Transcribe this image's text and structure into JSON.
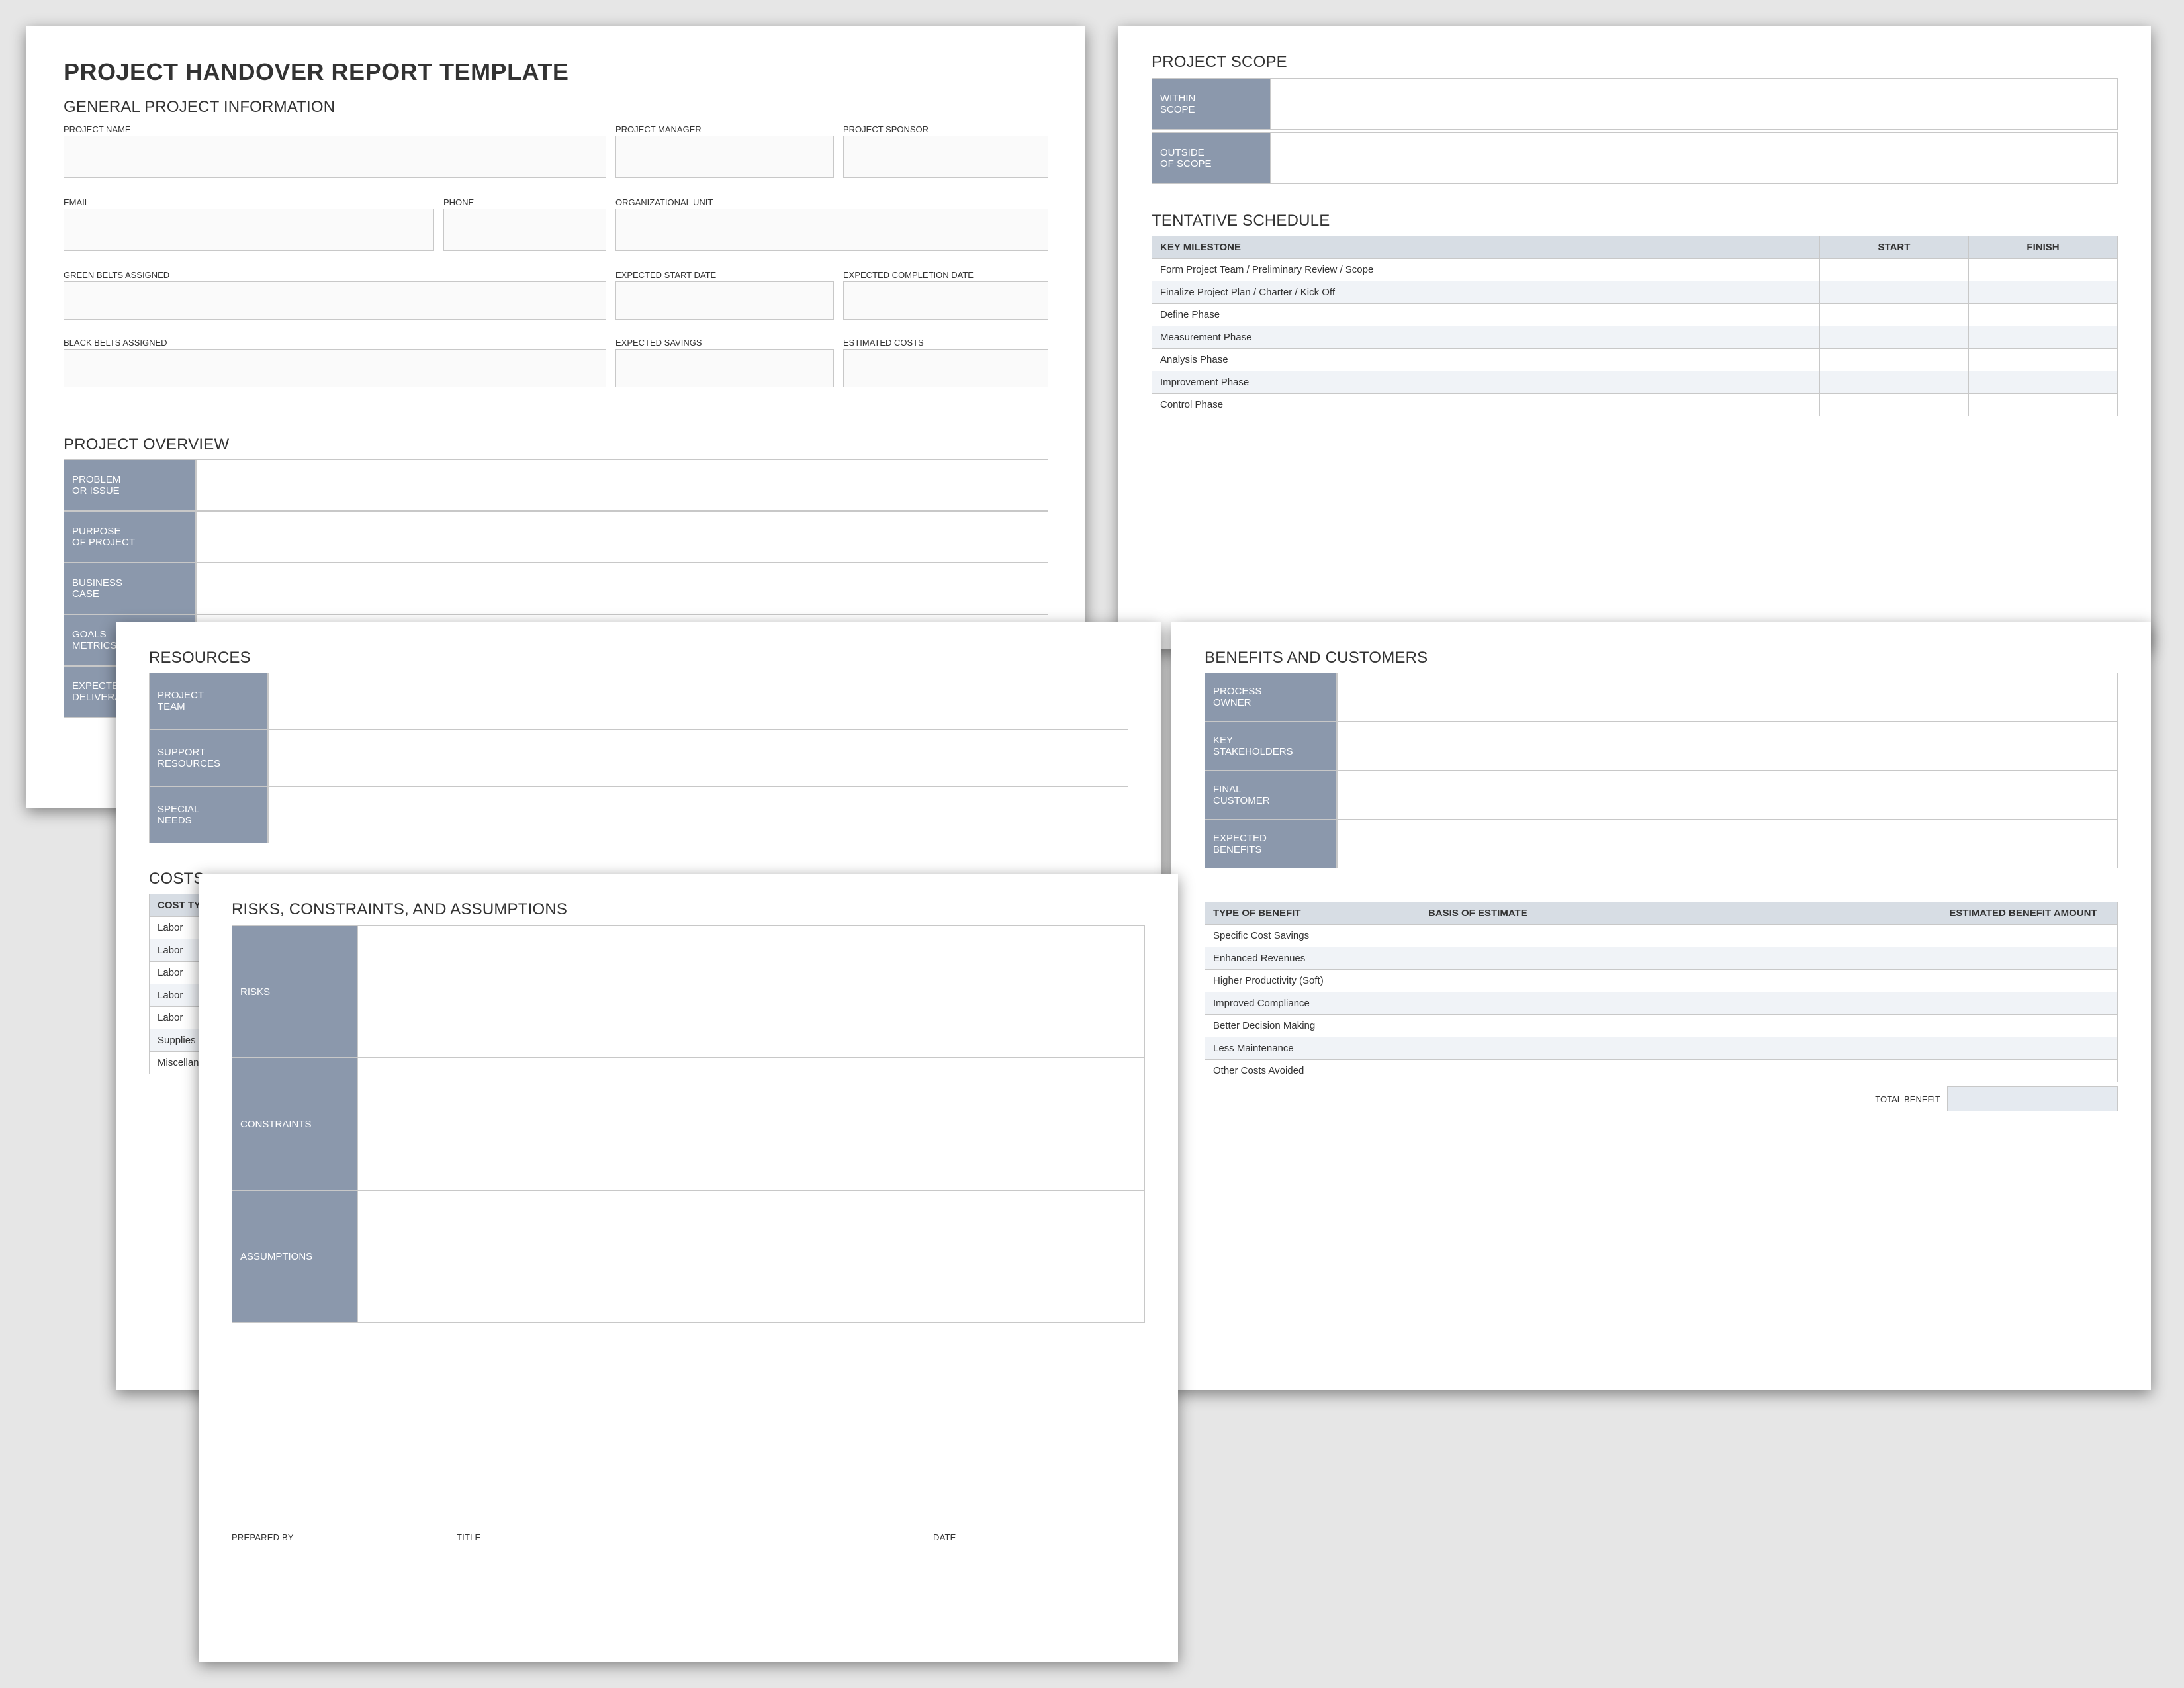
{
  "title": "PROJECT HANDOVER REPORT TEMPLATE",
  "general": {
    "heading": "GENERAL PROJECT INFORMATION",
    "project_name": "PROJECT NAME",
    "project_manager": "PROJECT MANAGER",
    "project_sponsor": "PROJECT SPONSOR",
    "email": "EMAIL",
    "phone": "PHONE",
    "org_unit": "ORGANIZATIONAL UNIT",
    "green_belts": "GREEN BELTS ASSIGNED",
    "exp_start": "EXPECTED START DATE",
    "exp_complete": "EXPECTED COMPLETION DATE",
    "black_belts": "BLACK BELTS ASSIGNED",
    "exp_savings": "EXPECTED SAVINGS",
    "est_costs": "ESTIMATED COSTS"
  },
  "overview": {
    "heading": "PROJECT OVERVIEW",
    "rows": [
      "PROBLEM\nOR ISSUE",
      "PURPOSE\nOF PROJECT",
      "BUSINESS\nCASE",
      "GOALS\nMETRICS",
      "EXPECTED\nDELIVERABLES"
    ]
  },
  "scope": {
    "heading": "PROJECT SCOPE",
    "within": "WITHIN\nSCOPE",
    "outside": "OUTSIDE\nOF SCOPE"
  },
  "schedule": {
    "heading": "TENTATIVE SCHEDULE",
    "cols": [
      "KEY MILESTONE",
      "START",
      "FINISH"
    ],
    "rows": [
      "Form Project Team / Preliminary Review / Scope",
      "Finalize Project Plan / Charter / Kick Off",
      "Define Phase",
      "Measurement Phase",
      "Analysis Phase",
      "Improvement Phase",
      "Control Phase"
    ]
  },
  "resources": {
    "heading": "RESOURCES",
    "rows": [
      "PROJECT\nTEAM",
      "SUPPORT\nRESOURCES",
      "SPECIAL\nNEEDS"
    ]
  },
  "costs": {
    "heading": "COSTS",
    "col_type": "COST TYPE",
    "rows": [
      "Labor",
      "Labor",
      "Labor",
      "Labor",
      "Labor",
      "Supplies",
      "Miscellaneous"
    ]
  },
  "risks": {
    "heading": "RISKS, CONSTRAINTS, AND ASSUMPTIONS",
    "rows": [
      "RISKS",
      "CONSTRAINTS",
      "ASSUMPTIONS"
    ]
  },
  "signoff": {
    "prepared_by": "PREPARED BY",
    "title": "TITLE",
    "date": "DATE"
  },
  "benefits": {
    "heading": "BENEFITS AND CUSTOMERS",
    "side_rows": [
      "PROCESS\nOWNER",
      "KEY\nSTAKEHOLDERS",
      "FINAL\nCUSTOMER",
      "EXPECTED\nBENEFITS"
    ],
    "table_cols": [
      "TYPE OF BENEFIT",
      "BASIS OF ESTIMATE",
      "ESTIMATED BENEFIT AMOUNT"
    ],
    "table_rows": [
      "Specific Cost Savings",
      "Enhanced Revenues",
      "Higher Productivity (Soft)",
      "Improved Compliance",
      "Better Decision Making",
      "Less Maintenance",
      "Other Costs Avoided"
    ],
    "total_label": "TOTAL BENEFIT"
  }
}
